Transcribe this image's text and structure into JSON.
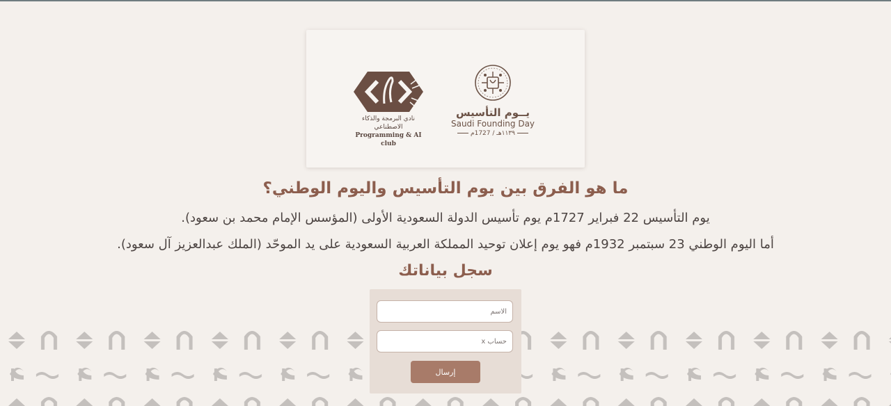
{
  "logos": {
    "club": {
      "name_ar": "نادي البرمجة والذكاء الاصطناعي",
      "name_en": "Programming & AI club",
      "icon": "code-brackets-icon"
    },
    "founding_day": {
      "title_ar": "يــوم التأسيس",
      "title_en": "Saudi Founding Day",
      "years": "١١٣٩هـ / 1727م",
      "icon": "founding-day-emblem-icon"
    }
  },
  "content": {
    "question": "ما هو الفرق بين يوم التأسيس واليوم الوطني؟",
    "paragraph1": "يوم التأسيس 22 فبراير 1727م يوم تأسيس الدولة السعودية الأولى (المؤسس الإمام محمد بن سعود).",
    "paragraph2": "أما اليوم الوطني 23 سبتمبر 1932م فهو يوم إعلان توحيد المملكة العربية السعودية على يد الموحّد (الملك عبدالعزيز آل سعود)."
  },
  "form": {
    "title": "سجل بياناتك",
    "name_placeholder": "الاسم",
    "account_placeholder": "حساب x",
    "submit_label": "إرسال"
  },
  "colors": {
    "page_background": "#f4f0ec",
    "heading": "#8c5e4e",
    "button": "#a87b69",
    "form_panel": "#e7ddd6",
    "pattern": "#c4c0bd"
  }
}
